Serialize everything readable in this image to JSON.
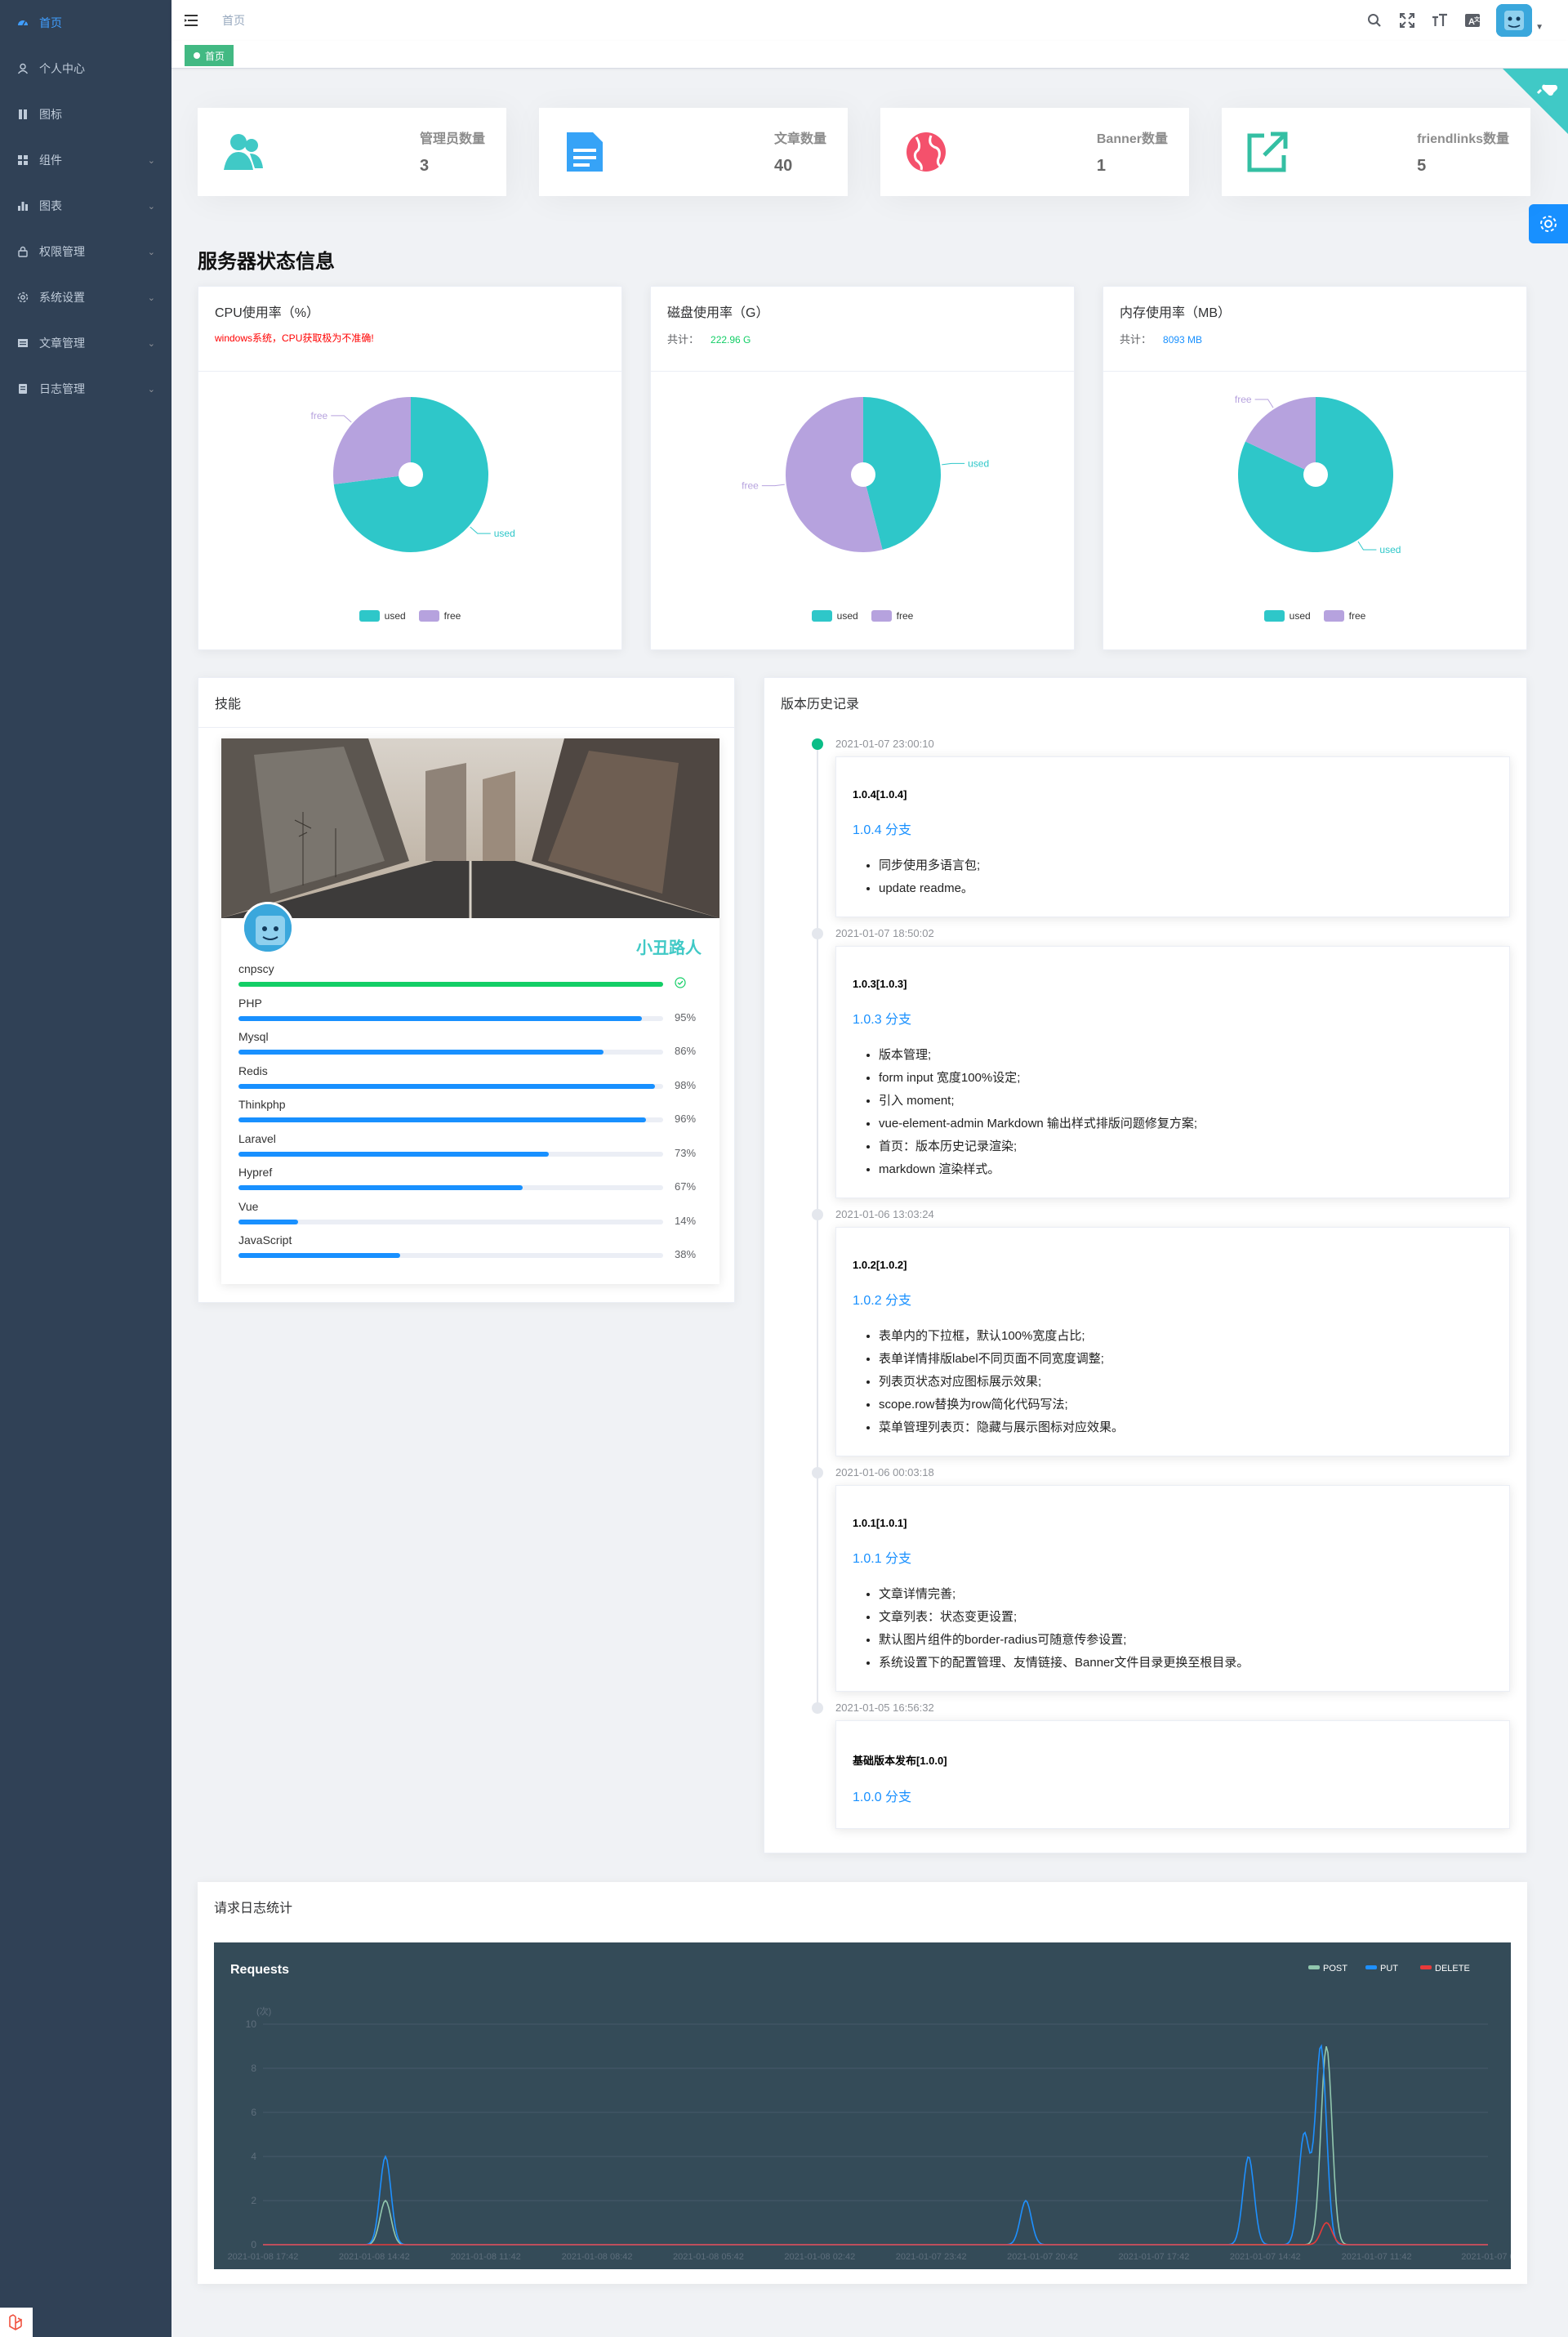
{
  "sidebar": {
    "items": [
      {
        "label": "首页",
        "icon": "dashboard-icon",
        "submenu": false,
        "active": true
      },
      {
        "label": "个人中心",
        "icon": "user-icon",
        "submenu": false,
        "active": false
      },
      {
        "label": "图标",
        "icon": "icons-icon",
        "submenu": false,
        "active": false
      },
      {
        "label": "组件",
        "icon": "component-icon",
        "submenu": true,
        "active": false
      },
      {
        "label": "图表",
        "icon": "chart-icon",
        "submenu": true,
        "active": false
      },
      {
        "label": "权限管理",
        "icon": "lock-icon",
        "submenu": true,
        "active": false
      },
      {
        "label": "系统设置",
        "icon": "settings-icon",
        "submenu": true,
        "active": false
      },
      {
        "label": "文章管理",
        "icon": "document-icon",
        "submenu": true,
        "active": false
      },
      {
        "label": "日志管理",
        "icon": "log-icon",
        "submenu": true,
        "active": false
      }
    ]
  },
  "navbar": {
    "breadcrumb": "首页",
    "icons": [
      "search-icon",
      "fullscreen-icon",
      "font-size-icon",
      "translate-icon"
    ]
  },
  "tags": {
    "active": "首页"
  },
  "panels": [
    {
      "label": "管理员数量",
      "value": "3",
      "icon": "people-icon",
      "color": "#40c9c6"
    },
    {
      "label": "文章数量",
      "value": "40",
      "icon": "document-icon",
      "color": "#36a3f7"
    },
    {
      "label": "Banner数量",
      "value": "1",
      "icon": "globe-icon",
      "color": "#f4516c"
    },
    {
      "label": "friendlinks数量",
      "value": "5",
      "icon": "external-link-icon",
      "color": "#34bfa3"
    }
  ],
  "server_title": "服务器状态信息",
  "server_cards": [
    {
      "title": "CPU使用率（%）",
      "sub_label": "",
      "sub_value": "windows系统，CPU获取极为不准确!",
      "sub_color": "#ff0000"
    },
    {
      "title": "磁盘使用率（G）",
      "sub_label": "共计：",
      "sub_value": "222.96 G",
      "sub_color": "#13ce66"
    },
    {
      "title": "内存使用率（MB）",
      "sub_label": "共计：",
      "sub_value": "8093 MB",
      "sub_color": "#1890ff"
    }
  ],
  "pie_legend": {
    "used": "used",
    "free": "free"
  },
  "colors": {
    "used": "#2ec7c9",
    "free": "#b6a2de",
    "accent": "#409eff",
    "sidebar": "#304156"
  },
  "chart_data": [
    {
      "type": "pie",
      "title": "CPU使用率（%）",
      "categories": [
        "used",
        "free"
      ],
      "values": [
        73,
        27
      ]
    },
    {
      "type": "pie",
      "title": "磁盘使用率（G）",
      "categories": [
        "used",
        "free"
      ],
      "values": [
        46,
        54
      ]
    },
    {
      "type": "pie",
      "title": "内存使用率（MB）",
      "categories": [
        "used",
        "free"
      ],
      "values": [
        82,
        18
      ]
    },
    {
      "type": "line",
      "title": "Requests",
      "ylabel": "(次)",
      "ylim": [
        0,
        10
      ],
      "yticks": [
        0,
        2,
        4,
        6,
        8,
        10
      ],
      "x": [
        "2021-01-08 17:42",
        "2021-01-08 14:42",
        "2021-01-08 11:42",
        "2021-01-08 08:42",
        "2021-01-08 05:42",
        "2021-01-08 02:42",
        "2021-01-07 23:42",
        "2021-01-07 20:42",
        "2021-01-07 17:42",
        "2021-01-07 14:42",
        "2021-01-07 11:42",
        "2021-01-07 0"
      ],
      "series": [
        {
          "name": "POST",
          "color": "#91c7ae",
          "peaks": [
            [
              1.1,
              2
            ],
            [
              9.55,
              9
            ]
          ]
        },
        {
          "name": "PUT",
          "color": "#1e90ff",
          "peaks": [
            [
              1.1,
              4
            ],
            [
              6.85,
              2
            ],
            [
              8.85,
              4
            ],
            [
              9.35,
              5
            ],
            [
              9.5,
              9
            ]
          ]
        },
        {
          "name": "DELETE",
          "color": "#e83a3a",
          "peaks": [
            [
              9.55,
              1
            ]
          ]
        }
      ]
    }
  ],
  "skills": {
    "title": "技能",
    "name": "小丑路人",
    "items": [
      {
        "name": "cnpscy",
        "percent": 100,
        "status": "success"
      },
      {
        "name": "PHP",
        "percent": 95
      },
      {
        "name": "Mysql",
        "percent": 86
      },
      {
        "name": "Redis",
        "percent": 98
      },
      {
        "name": "Thinkphp",
        "percent": 96
      },
      {
        "name": "Laravel",
        "percent": 73
      },
      {
        "name": "Hypref",
        "percent": 67
      },
      {
        "name": "Vue",
        "percent": 14
      },
      {
        "name": "JavaScript",
        "percent": 38
      }
    ]
  },
  "history": {
    "title": "版本历史记录",
    "entries": [
      {
        "time": "2021-01-07 23:00:10",
        "version": "1.0.4[1.0.4]",
        "branch": "1.0.4 分支",
        "items": [
          "同步使用多语言包;",
          "update readme。"
        ]
      },
      {
        "time": "2021-01-07 18:50:02",
        "version": "1.0.3[1.0.3]",
        "branch": "1.0.3 分支",
        "items": [
          "版本管理;",
          "form input 宽度100%设定;",
          "引入 moment;",
          "vue-element-admin Markdown 输出样式排版问题修复方案;",
          "首页：版本历史记录渲染;",
          "markdown 渲染样式。"
        ]
      },
      {
        "time": "2021-01-06 13:03:24",
        "version": "1.0.2[1.0.2]",
        "branch": "1.0.2 分支",
        "items": [
          "表单内的下拉框，默认100%宽度占比;",
          "表单详情排版label不同页面不同宽度调整;",
          "列表页状态对应图标展示效果;",
          "scope.row替换为row简化代码写法;",
          "菜单管理列表页：隐藏与展示图标对应效果。"
        ]
      },
      {
        "time": "2021-01-06 00:03:18",
        "version": "1.0.1[1.0.1]",
        "branch": "1.0.1 分支",
        "items": [
          "文章详情完善;",
          "文章列表：状态变更设置;",
          "默认图片组件的border-radius可随意传参设置;",
          "系统设置下的配置管理、友情链接、Banner文件目录更换至根目录。"
        ]
      },
      {
        "time": "2021-01-05 16:56:32",
        "version": "基础版本发布[1.0.0]",
        "branch": "1.0.0 分支",
        "items": []
      }
    ]
  },
  "log": {
    "title": "请求日志统计"
  }
}
